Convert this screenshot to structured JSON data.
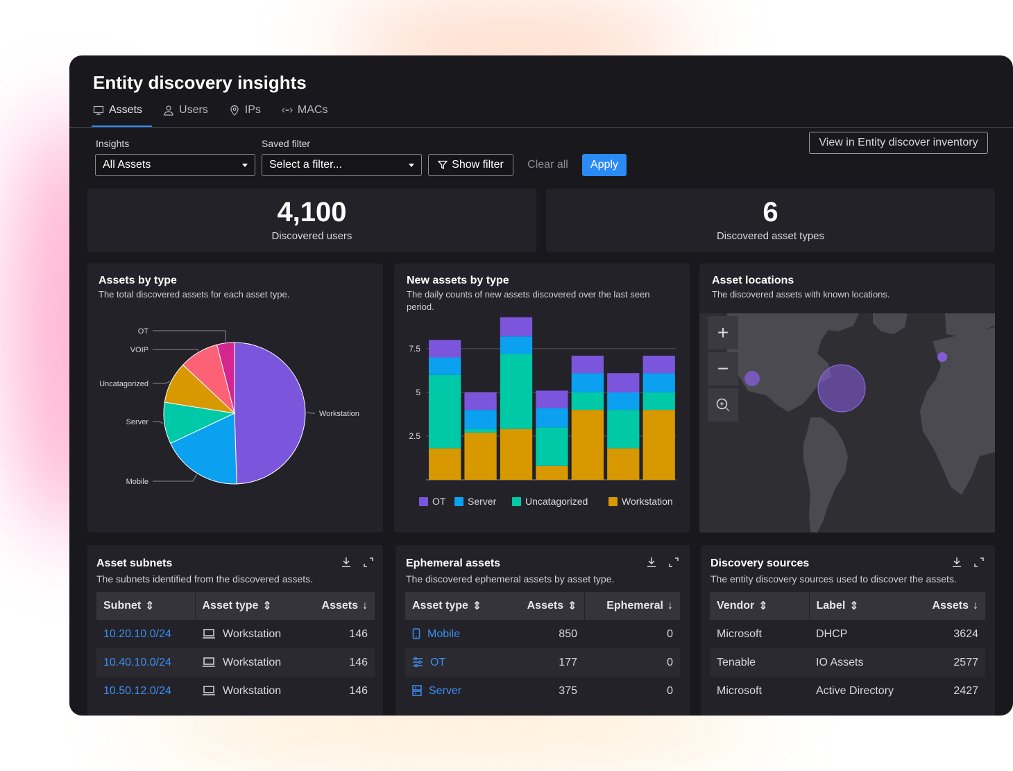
{
  "page": {
    "title": "Entity discovery insights",
    "tabs": [
      {
        "label": "Assets",
        "icon": "monitor-icon",
        "active": true
      },
      {
        "label": "Users",
        "icon": "user-icon",
        "active": false
      },
      {
        "label": "IPs",
        "icon": "location-pin-icon",
        "active": false
      },
      {
        "label": "MACs",
        "icon": "code-arrows-icon",
        "active": false
      }
    ]
  },
  "filters": {
    "insights_label": "Insights",
    "insights_value": "All Assets",
    "saved_label": "Saved filter",
    "saved_value": "Select a filter...",
    "show_filter": "Show filter",
    "clear_all": "Clear all",
    "apply": "Apply",
    "view_inventory": "View in Entity discover inventory"
  },
  "kpis": [
    {
      "value": "4,100",
      "label": "Discovered users"
    },
    {
      "value": "6",
      "label": "Discovered asset types"
    }
  ],
  "colors": {
    "OT": "#7b55dc",
    "VOIP": "#e0309a",
    "Uncatagorized": "#00c9a7",
    "Server": "#0ca0f0",
    "Workstation": "#d89800",
    "Mobile": "#0ca0f0",
    "pie_voip": "#d4268e",
    "pie_ot": "#fc6175",
    "pie_uncat": "#d89800",
    "pie_server": "#00c9a7",
    "pie_mobile": "#0ca0f0",
    "pie_workstation": "#7b55dc",
    "accent": "#2a8af6"
  },
  "assets_by_type": {
    "title": "Assets by type",
    "subtitle": "The total discovered assets for each asset type.",
    "chart_data": {
      "type": "pie",
      "slices": [
        {
          "label": "Workstation",
          "value": 49.5
        },
        {
          "label": "Mobile",
          "value": 18.5
        },
        {
          "label": "Server",
          "value": 9.5
        },
        {
          "label": "Uncatagorized",
          "value": 9.5
        },
        {
          "label": "VOIP",
          "value": 9.0
        },
        {
          "label": "OT",
          "value": 4.0
        }
      ]
    }
  },
  "new_assets_by_type": {
    "title": "New assets by type",
    "subtitle": "The daily counts of new assets discovered over the last seen period.",
    "chart_data": {
      "type": "bar",
      "stacked": true,
      "categories": [
        "",
        "",
        "",
        "",
        "",
        "",
        ""
      ],
      "series": [
        {
          "name": "Workstation",
          "values": [
            1.8,
            2.7,
            2.9,
            0.8,
            4.0,
            1.8,
            4.0
          ]
        },
        {
          "name": "Uncatagorized",
          "values": [
            4.2,
            0.2,
            4.3,
            2.2,
            1.0,
            2.2,
            1.0
          ]
        },
        {
          "name": "Server",
          "values": [
            1.0,
            1.1,
            1.0,
            1.1,
            1.1,
            1.0,
            1.1
          ]
        },
        {
          "name": "OT",
          "values": [
            1.0,
            1.0,
            1.1,
            1.0,
            1.0,
            1.1,
            1.0
          ]
        }
      ],
      "yticks": [
        2.5,
        5,
        7.5
      ],
      "ylim": [
        0,
        9.2
      ],
      "grid": true,
      "legend": "bottom"
    }
  },
  "asset_locations": {
    "title": "Asset locations",
    "subtitle": "The discovered assets with known locations.",
    "zoom_in": "+",
    "zoom_out": "−"
  },
  "asset_subnets": {
    "title": "Asset subnets",
    "subtitle": "The subnets identified from the discovered assets.",
    "headers": [
      "Subnet",
      "Asset type",
      "Assets"
    ],
    "rows": [
      {
        "subnet": "10.20.10.0/24",
        "type": "Workstation",
        "assets": "146"
      },
      {
        "subnet": "10.40.10.0/24",
        "type": "Workstation",
        "assets": "146"
      },
      {
        "subnet": "10.50.12.0/24",
        "type": "Workstation",
        "assets": "146"
      }
    ]
  },
  "ephemeral_assets": {
    "title": "Ephemeral assets",
    "subtitle": "The discovered ephemeral assets by asset type.",
    "headers": [
      "Asset type",
      "Assets",
      "Ephemeral"
    ],
    "rows": [
      {
        "type": "Mobile",
        "icon": "mobile-icon",
        "assets": "850",
        "ephemeral": "0"
      },
      {
        "type": "OT",
        "icon": "sliders-icon",
        "assets": "177",
        "ephemeral": "0"
      },
      {
        "type": "Server",
        "icon": "server-icon",
        "assets": "375",
        "ephemeral": "0"
      }
    ]
  },
  "discovery_sources": {
    "title": "Discovery sources",
    "subtitle": "The entity discovery sources used to discover the assets.",
    "headers": [
      "Vendor",
      "Label",
      "Assets"
    ],
    "rows": [
      {
        "vendor": "Microsoft",
        "label": "DHCP",
        "assets": "3624"
      },
      {
        "vendor": "Tenable",
        "label": "IO Assets",
        "assets": "2577"
      },
      {
        "vendor": "Microsoft",
        "label": "Active Directory",
        "assets": "2427"
      }
    ]
  }
}
